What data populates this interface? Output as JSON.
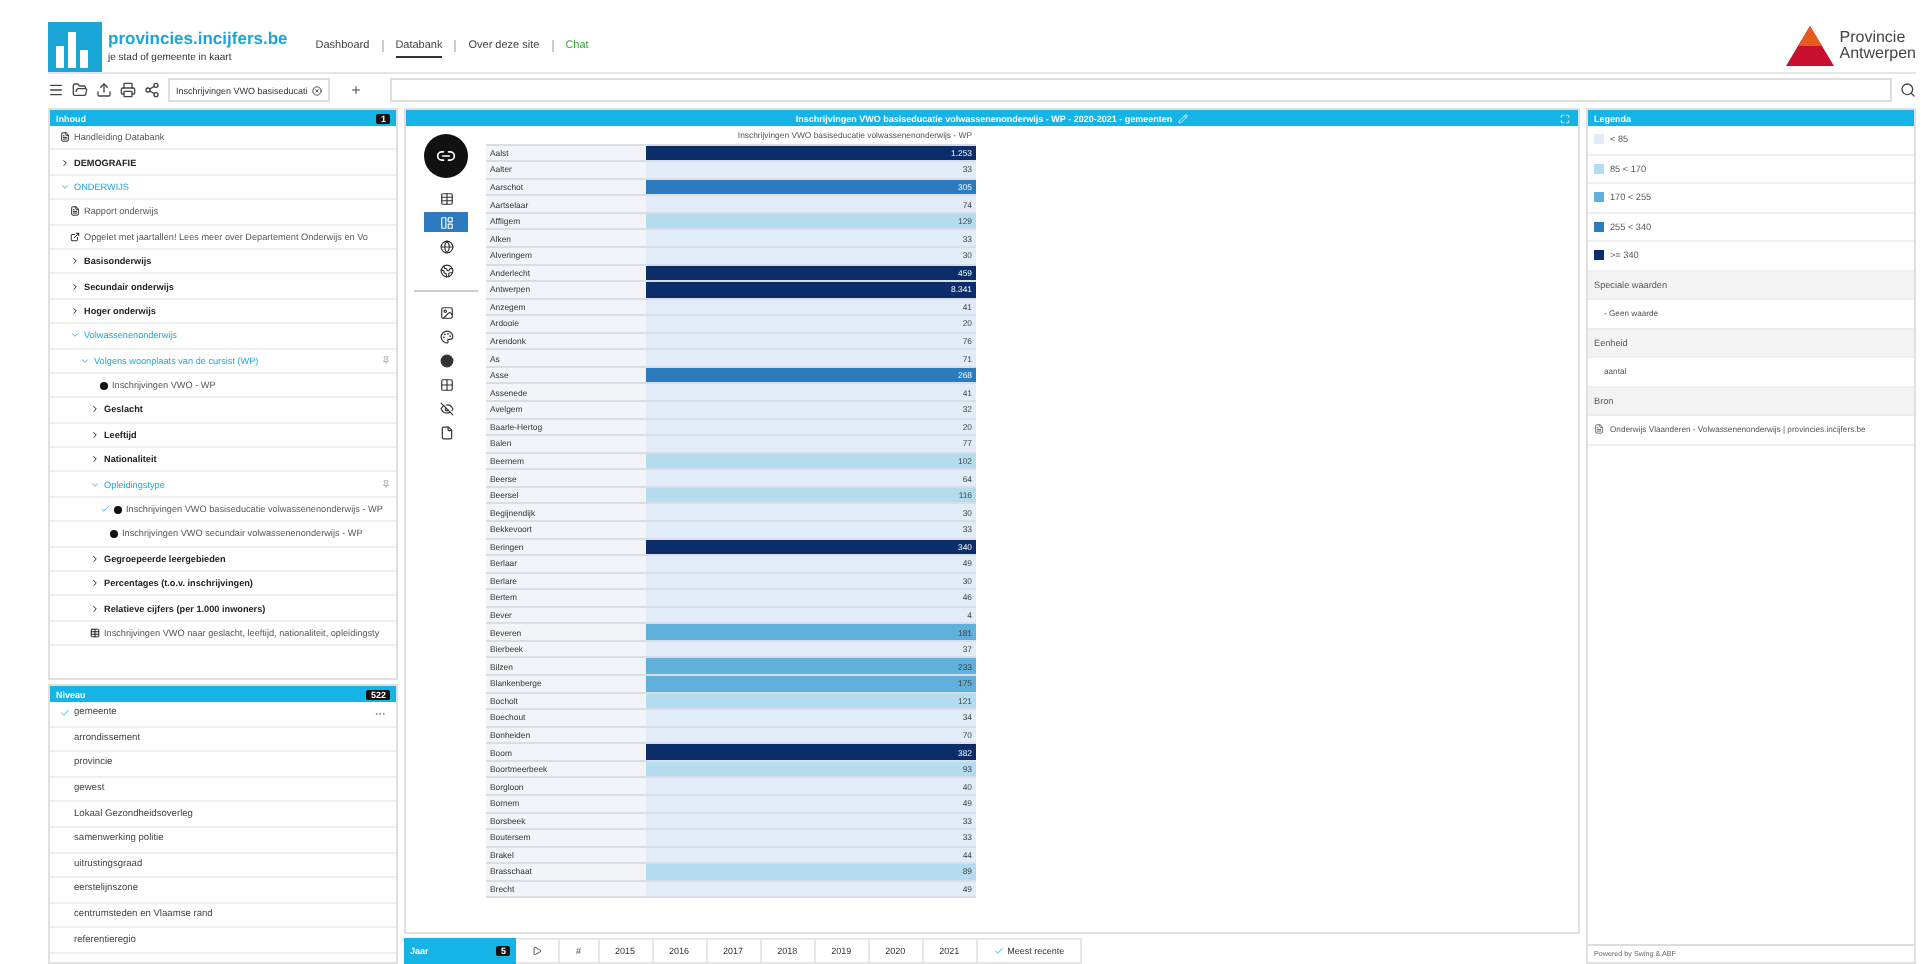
{
  "header": {
    "logo_title": "provincies.incijfers.be",
    "logo_subtitle": "je stad of gemeente in kaart",
    "nav": [
      {
        "label": "Dashboard",
        "selected": false,
        "kind": "link"
      },
      {
        "label": "Databank",
        "selected": true,
        "kind": "link"
      },
      {
        "label": "Over deze site",
        "selected": false,
        "kind": "link"
      },
      {
        "label": "Chat",
        "selected": false,
        "kind": "chat"
      }
    ],
    "brand": [
      "Provincie",
      "Antwerpen"
    ]
  },
  "toolbar": {
    "tab": "Inschrijvingen VWO basiseducati"
  },
  "contents": {
    "title": "Inhoud",
    "count": "1",
    "items": [
      {
        "kind": "doc",
        "label": "Handleiding Databank"
      },
      {
        "kind": "folder",
        "label": "DEMOGRAFIE",
        "expanded": false,
        "pinned": false
      },
      {
        "kind": "folder",
        "label": "ONDERWIJS",
        "expanded": true,
        "pinned": false,
        "children": [
          {
            "kind": "doc",
            "label": "Rapport onderwijs"
          },
          {
            "kind": "warning",
            "label": "Opgelet met jaartallen! Lees meer over Departement Onderwijs en Vo"
          },
          {
            "kind": "folder",
            "label": "Basisonderwijs",
            "expanded": false,
            "pinned": false
          },
          {
            "kind": "folder",
            "label": "Secundair onderwijs",
            "expanded": false,
            "pinned": false
          },
          {
            "kind": "folder",
            "label": "Hoger onderwijs",
            "expanded": false,
            "pinned": false
          },
          {
            "kind": "folder",
            "label": "Volwassenenonderwijs",
            "expanded": true,
            "pinned": false,
            "children": [
              {
                "kind": "folder",
                "label": "Volgens woonplaats van de cursist (WP)",
                "expanded": true,
                "pinned": true,
                "children": [
                  {
                    "kind": "indicator",
                    "label": "Inschrijvingen VWO - WP",
                    "checked": false
                  },
                  {
                    "kind": "folder",
                    "label": "Geslacht",
                    "expanded": false,
                    "pinned": false
                  },
                  {
                    "kind": "folder",
                    "label": "Leeftijd",
                    "expanded": false,
                    "pinned": false
                  },
                  {
                    "kind": "folder",
                    "label": "Nationaliteit",
                    "expanded": false,
                    "pinned": false
                  },
                  {
                    "kind": "folder",
                    "label": "Opleidingstype",
                    "expanded": true,
                    "pinned": true,
                    "children": [
                      {
                        "kind": "indicator",
                        "label": "Inschrijvingen VWO basiseducatie volwassenenonderwijs - WP",
                        "checked": true
                      },
                      {
                        "kind": "indicator",
                        "label": "Inschrijvingen VWO secundair volwassenenonderwijs - WP",
                        "checked": false
                      }
                    ]
                  },
                  {
                    "kind": "folder",
                    "label": "Gegroepeerde leergebieden",
                    "expanded": false,
                    "pinned": false
                  },
                  {
                    "kind": "folder",
                    "label": "Percentages (t.o.v. inschrijvingen)",
                    "expanded": false,
                    "pinned": false
                  },
                  {
                    "kind": "folder",
                    "label": "Relatieve cijfers (per 1.000 inwoners)",
                    "expanded": false,
                    "pinned": false
                  },
                  {
                    "kind": "table",
                    "label": "Inschrijvingen VWO naar geslacht, leeftijd, nationaliteit, opleidingsty"
                  }
                ]
              }
            ]
          }
        ]
      }
    ]
  },
  "levels": {
    "title": "Niveau",
    "count": "522",
    "items": [
      {
        "label": "gemeente",
        "selected": true
      },
      {
        "label": "arrondissement",
        "selected": false
      },
      {
        "label": "provincie",
        "selected": false
      },
      {
        "label": "gewest",
        "selected": false
      },
      {
        "label": "Lokaal Gezondheidsoverleg",
        "selected": false
      },
      {
        "label": "samenwerking politie",
        "selected": false
      },
      {
        "label": "uitrustingsgraad",
        "selected": false
      },
      {
        "label": "eerstelijnszone",
        "selected": false
      },
      {
        "label": "centrumsteden en Vlaamse rand",
        "selected": false
      },
      {
        "label": "referentieregio",
        "selected": false
      }
    ]
  },
  "view": {
    "title": "Inschrijvingen VWO basiseducatie volwassenenonderwijs - WP - 2020-2021 - gemeenten",
    "column": "Inschrijvingen VWO basiseducatie volwassenenonderwijs - WP",
    "tool_groups": [
      [
        {
          "kind": "table",
          "selected": false
        },
        {
          "kind": "maptable",
          "selected": true
        },
        {
          "kind": "globe",
          "selected": false
        },
        {
          "kind": "globe-gear",
          "selected": false
        }
      ],
      [
        {
          "kind": "image",
          "selected": false
        },
        {
          "kind": "palette",
          "selected": false
        },
        {
          "kind": "ball",
          "selected": false
        },
        {
          "kind": "grid",
          "selected": false
        },
        {
          "kind": "eye-off",
          "selected": false
        },
        {
          "kind": "file",
          "selected": false
        }
      ]
    ],
    "rows": [
      {
        "name": "Aalst",
        "value": "1.253",
        "color": "#0b2e6b"
      },
      {
        "name": "Aalter",
        "value": "33",
        "color": "#e1ecf8"
      },
      {
        "name": "Aarschot",
        "value": "305",
        "color": "#2c7bbf"
      },
      {
        "name": "Aartselaar",
        "value": "74",
        "color": "#e1ecf8"
      },
      {
        "name": "Affligem",
        "value": "129",
        "color": "#b4dbee"
      },
      {
        "name": "Alken",
        "value": "33",
        "color": "#e1ecf8"
      },
      {
        "name": "Alveringem",
        "value": "30",
        "color": "#e1ecf8"
      },
      {
        "name": "Anderlecht",
        "value": "459",
        "color": "#0b2e6b"
      },
      {
        "name": "Antwerpen",
        "value": "8.341",
        "color": "#0b2e6b"
      },
      {
        "name": "Anzegem",
        "value": "41",
        "color": "#e1ecf8"
      },
      {
        "name": "Ardooie",
        "value": "20",
        "color": "#e1ecf8"
      },
      {
        "name": "Arendonk",
        "value": "76",
        "color": "#e1ecf8"
      },
      {
        "name": "As",
        "value": "71",
        "color": "#e1ecf8"
      },
      {
        "name": "Asse",
        "value": "268",
        "color": "#2c7bbf"
      },
      {
        "name": "Assenede",
        "value": "41",
        "color": "#e1ecf8"
      },
      {
        "name": "Avelgem",
        "value": "32",
        "color": "#e1ecf8"
      },
      {
        "name": "Baarle-Hertog",
        "value": "20",
        "color": "#e1ecf8"
      },
      {
        "name": "Balen",
        "value": "77",
        "color": "#e1ecf8"
      },
      {
        "name": "Beernem",
        "value": "102",
        "color": "#b4dbee"
      },
      {
        "name": "Beerse",
        "value": "64",
        "color": "#e1ecf8"
      },
      {
        "name": "Beersel",
        "value": "116",
        "color": "#b4dbee"
      },
      {
        "name": "Begijnendijk",
        "value": "30",
        "color": "#e1ecf8"
      },
      {
        "name": "Bekkevoort",
        "value": "33",
        "color": "#e1ecf8"
      },
      {
        "name": "Beringen",
        "value": "340",
        "color": "#0b2e6b"
      },
      {
        "name": "Berlaar",
        "value": "49",
        "color": "#e1ecf8"
      },
      {
        "name": "Berlare",
        "value": "30",
        "color": "#e1ecf8"
      },
      {
        "name": "Bertem",
        "value": "46",
        "color": "#e1ecf8"
      },
      {
        "name": "Bever",
        "value": "4",
        "color": "#e1ecf8"
      },
      {
        "name": "Beveren",
        "value": "181",
        "color": "#5fb0da"
      },
      {
        "name": "Bierbeek",
        "value": "37",
        "color": "#e1ecf8"
      },
      {
        "name": "Bilzen",
        "value": "233",
        "color": "#5fb0da"
      },
      {
        "name": "Blankenberge",
        "value": "175",
        "color": "#5fb0da"
      },
      {
        "name": "Bocholt",
        "value": "121",
        "color": "#b4dbee"
      },
      {
        "name": "Boechout",
        "value": "34",
        "color": "#e1ecf8"
      },
      {
        "name": "Bonheiden",
        "value": "70",
        "color": "#e1ecf8"
      },
      {
        "name": "Boom",
        "value": "382",
        "color": "#0b2e6b"
      },
      {
        "name": "Boortmeerbeek",
        "value": "93",
        "color": "#b4dbee"
      },
      {
        "name": "Borgloon",
        "value": "40",
        "color": "#e1ecf8"
      },
      {
        "name": "Bornem",
        "value": "49",
        "color": "#e1ecf8"
      },
      {
        "name": "Borsbeek",
        "value": "33",
        "color": "#e1ecf8"
      },
      {
        "name": "Boutersem",
        "value": "33",
        "color": "#e1ecf8"
      },
      {
        "name": "Brakel",
        "value": "44",
        "color": "#e1ecf8"
      },
      {
        "name": "Brasschaat",
        "value": "89",
        "color": "#b4dbee"
      },
      {
        "name": "Brecht",
        "value": "49",
        "color": "#e1ecf8"
      }
    ]
  },
  "years": {
    "title": "Jaar",
    "count": "5",
    "hash": "#",
    "items": [
      "2015",
      "2016",
      "2017",
      "2018",
      "2019",
      "2020",
      "2021"
    ],
    "latest": {
      "label": "Meest recente",
      "checked": true
    }
  },
  "legend": {
    "title": "Legenda",
    "classes": [
      {
        "label": "< 85",
        "color": "#e1ecf8"
      },
      {
        "label": "85 < 170",
        "color": "#b4dbee"
      },
      {
        "label": "170 < 255",
        "color": "#5fb0da"
      },
      {
        "label": "255 < 340",
        "color": "#2c7bbf"
      },
      {
        "label": ">= 340",
        "color": "#0b2e6b"
      }
    ],
    "sections": [
      {
        "heading": "Speciale waarden",
        "value": "- Geen waarde",
        "kind": "text"
      },
      {
        "heading": "Eenheid",
        "value": "aantal",
        "kind": "text"
      },
      {
        "heading": "Bron",
        "value": "Onderwijs Vlaanderen - Volwassenenonderwijs | provincies.incijfers.be",
        "kind": "source"
      }
    ],
    "footer": "Powered by Swing & ABF"
  }
}
